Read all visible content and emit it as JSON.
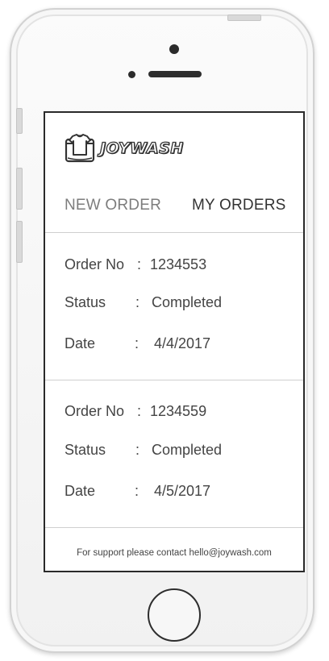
{
  "app": {
    "brand": "JOYWASH"
  },
  "tabs": [
    {
      "label": "NEW ORDER",
      "active": false
    },
    {
      "label": "MY ORDERS",
      "active": true
    }
  ],
  "field_labels": {
    "order_no": "Order No",
    "status": "Status",
    "date": "Date",
    "separator": ":"
  },
  "orders": [
    {
      "order_no": "1234553",
      "status": "Completed",
      "date": "4/4/2017"
    },
    {
      "order_no": "1234559",
      "status": "Completed",
      "date": "4/5/2017"
    }
  ],
  "footer": {
    "text": "For support please contact hello@joywash.com"
  },
  "colors": {
    "inactive_tab": "#7d7d7d",
    "active_tab": "#333333",
    "body_text": "#444444",
    "divider": "#cfcfcf"
  },
  "icons": {
    "logo": "washing-machine-shirt-icon"
  }
}
